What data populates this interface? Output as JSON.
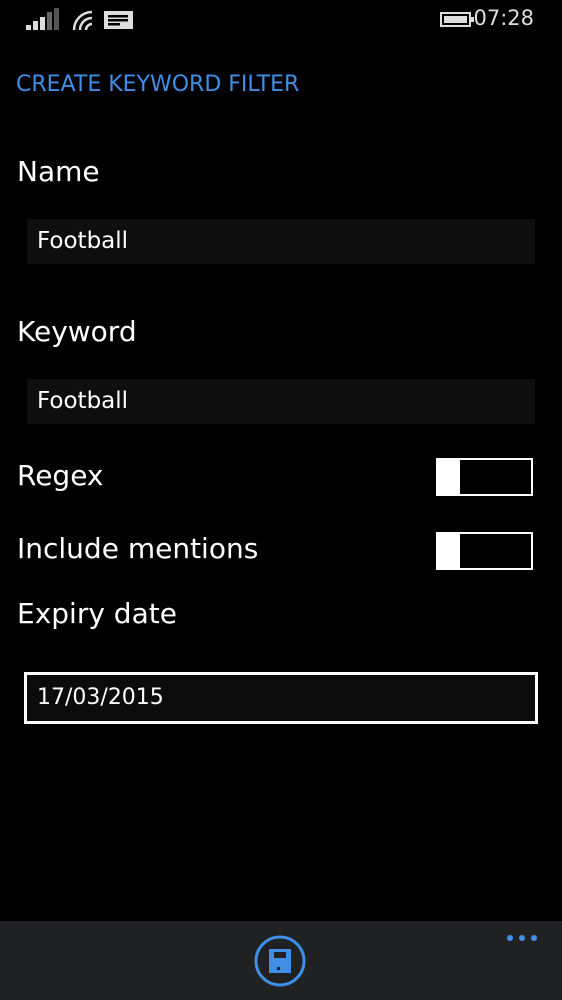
{
  "status": {
    "time": "07:28",
    "icons": [
      "signal-icon",
      "wifi-icon",
      "message-icon",
      "battery-icon"
    ]
  },
  "page": {
    "title": "CREATE KEYWORD FILTER"
  },
  "form": {
    "name_label": "Name",
    "name_value": "Football",
    "keyword_label": "Keyword",
    "keyword_value": "Football",
    "regex_label": "Regex",
    "regex_on": false,
    "mentions_label": "Include mentions",
    "mentions_on": false,
    "expiry_label": "Expiry date",
    "expiry_value": "17/03/2015"
  },
  "appbar": {
    "icons": [
      "save-icon",
      "more-icon"
    ],
    "accent": "#3f8fe6"
  }
}
